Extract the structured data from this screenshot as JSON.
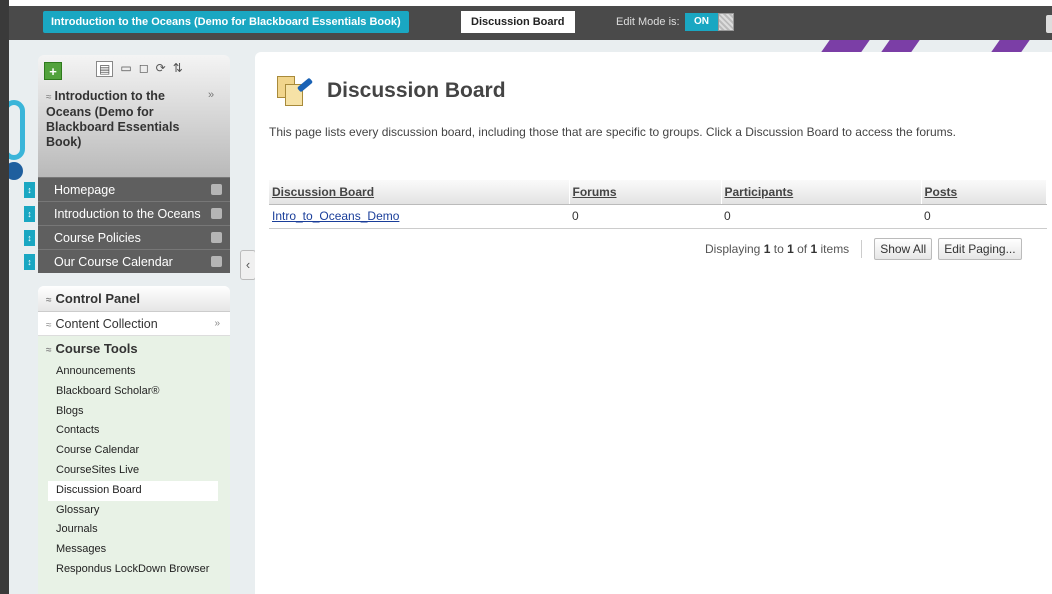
{
  "topbar": {
    "course_title": "Introduction to the Oceans (Demo for Blackboard Essentials Book)",
    "page_crumb": "Discussion Board",
    "edit_mode_label": "Edit Mode is:",
    "edit_mode_value": "ON",
    "help_label": "?"
  },
  "course_menu": {
    "title": "Introduction to the Oceans (Demo for Blackboard Essentials Book)",
    "items": [
      {
        "label": "Homepage"
      },
      {
        "label": "Introduction to the Oceans"
      },
      {
        "label": "Course Policies"
      },
      {
        "label": "Our Course Calendar"
      }
    ]
  },
  "control_panel": {
    "title": "Control Panel",
    "content_collection": "Content Collection",
    "course_tools": "Course Tools",
    "tools": [
      "Announcements",
      "Blackboard Scholar®",
      "Blogs",
      "Contacts",
      "Course Calendar",
      "CourseSites Live",
      "Discussion Board",
      "Glossary",
      "Journals",
      "Messages",
      "Respondus LockDown Browser"
    ]
  },
  "main": {
    "title": "Discussion Board",
    "intro": "This page lists every discussion board, including those that are specific to groups. Click a Discussion Board to access the forums.",
    "columns": [
      "Discussion Board",
      "Forums",
      "Participants",
      "Posts"
    ],
    "rows": [
      {
        "name": "Intro_to_Oceans_Demo",
        "forums": "0",
        "participants": "0",
        "posts": "0"
      }
    ],
    "paging": {
      "prefix": "Displaying",
      "from": "1",
      "to_word": "to",
      "to": "1",
      "of_word": "of",
      "total": "1",
      "suffix": "items",
      "show_all": "Show All",
      "edit_paging": "Edit Paging..."
    }
  }
}
